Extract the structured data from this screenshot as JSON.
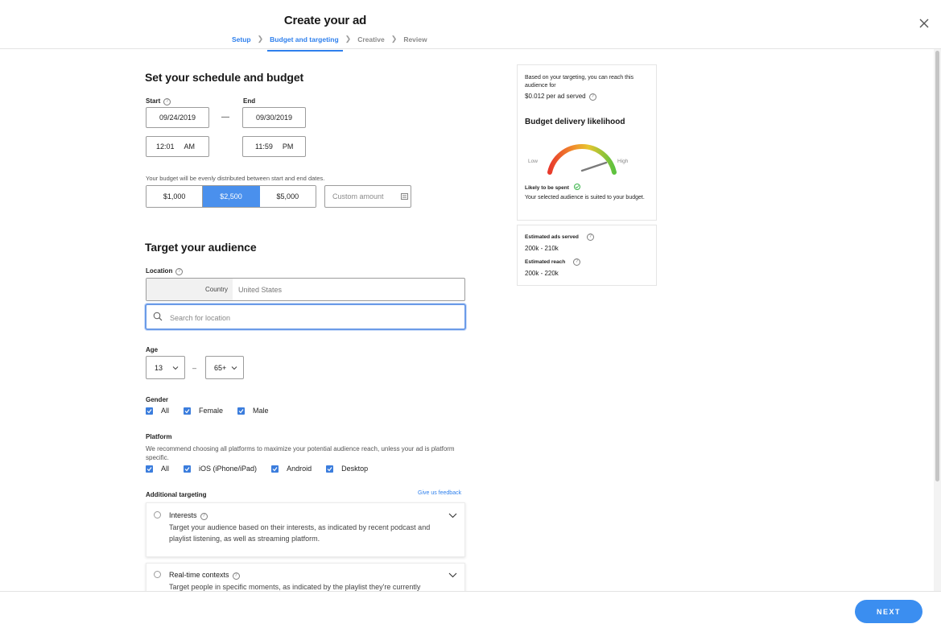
{
  "header": {
    "title": "Create your ad",
    "steps": [
      {
        "label": "Setup"
      },
      {
        "label": "Budget and targeting"
      },
      {
        "label": "Creative"
      },
      {
        "label": "Review"
      }
    ]
  },
  "schedule": {
    "title": "Set your schedule and budget",
    "start_label": "Start",
    "end_label": "End",
    "start_date": "09/24/2019",
    "end_date": "09/30/2019",
    "start_time": "12:01",
    "start_ampm": "AM",
    "end_time": "11:59",
    "end_ampm": "PM",
    "dash": "—",
    "budget_note": "Your budget will be evenly distributed between start and end dates.",
    "budget_options": [
      "$1,000",
      "$2,500",
      "$5,000"
    ],
    "selected_budget": "$2,500",
    "custom_placeholder": "Custom amount"
  },
  "audience": {
    "title": "Target your audience",
    "location_label": "Location",
    "location_type": "Country",
    "location_value": "United States",
    "search_placeholder": "Search for location",
    "age_label": "Age",
    "age_min": "13",
    "age_max": "65+",
    "age_dash": "–",
    "gender_label": "Gender",
    "gender_options": [
      "All",
      "Female",
      "Male"
    ],
    "platform_label": "Platform",
    "platform_note": "We recommend choosing all platforms to maximize your potential audience reach, unless your ad is platform specific.",
    "platform_options": [
      "All",
      "iOS (iPhone/iPad)",
      "Android",
      "Desktop"
    ],
    "additional_label": "Additional targeting",
    "feedback_link": "Give us feedback",
    "targeting_cards": [
      {
        "title": "Interests",
        "description": "Target your audience based on their interests, as indicated by recent podcast and playlist listening, as well as streaming platform."
      },
      {
        "title": "Real-time contexts",
        "description": "Target people in specific moments, as indicated by the playlist they're currently"
      }
    ]
  },
  "summary": {
    "reach_note": "Based on your targeting, you can reach this audience for",
    "price": "$0.012 per ad served",
    "likelihood_title": "Budget delivery likelihood",
    "low_label": "Low",
    "high_label": "High",
    "likely_label": "Likely to be spent",
    "likely_desc": "Your selected audience is suited to your budget.",
    "est_ads_label": "Estimated ads served",
    "est_ads_value": "200k - 210k",
    "est_reach_label": "Estimated reach",
    "est_reach_value": "200k - 220k"
  },
  "footer": {
    "next_label": "NEXT"
  },
  "colors": {
    "accent": "#2f80ed",
    "selected_budget_bg": "#4a90ed",
    "next_button": "#3b8ef0"
  }
}
